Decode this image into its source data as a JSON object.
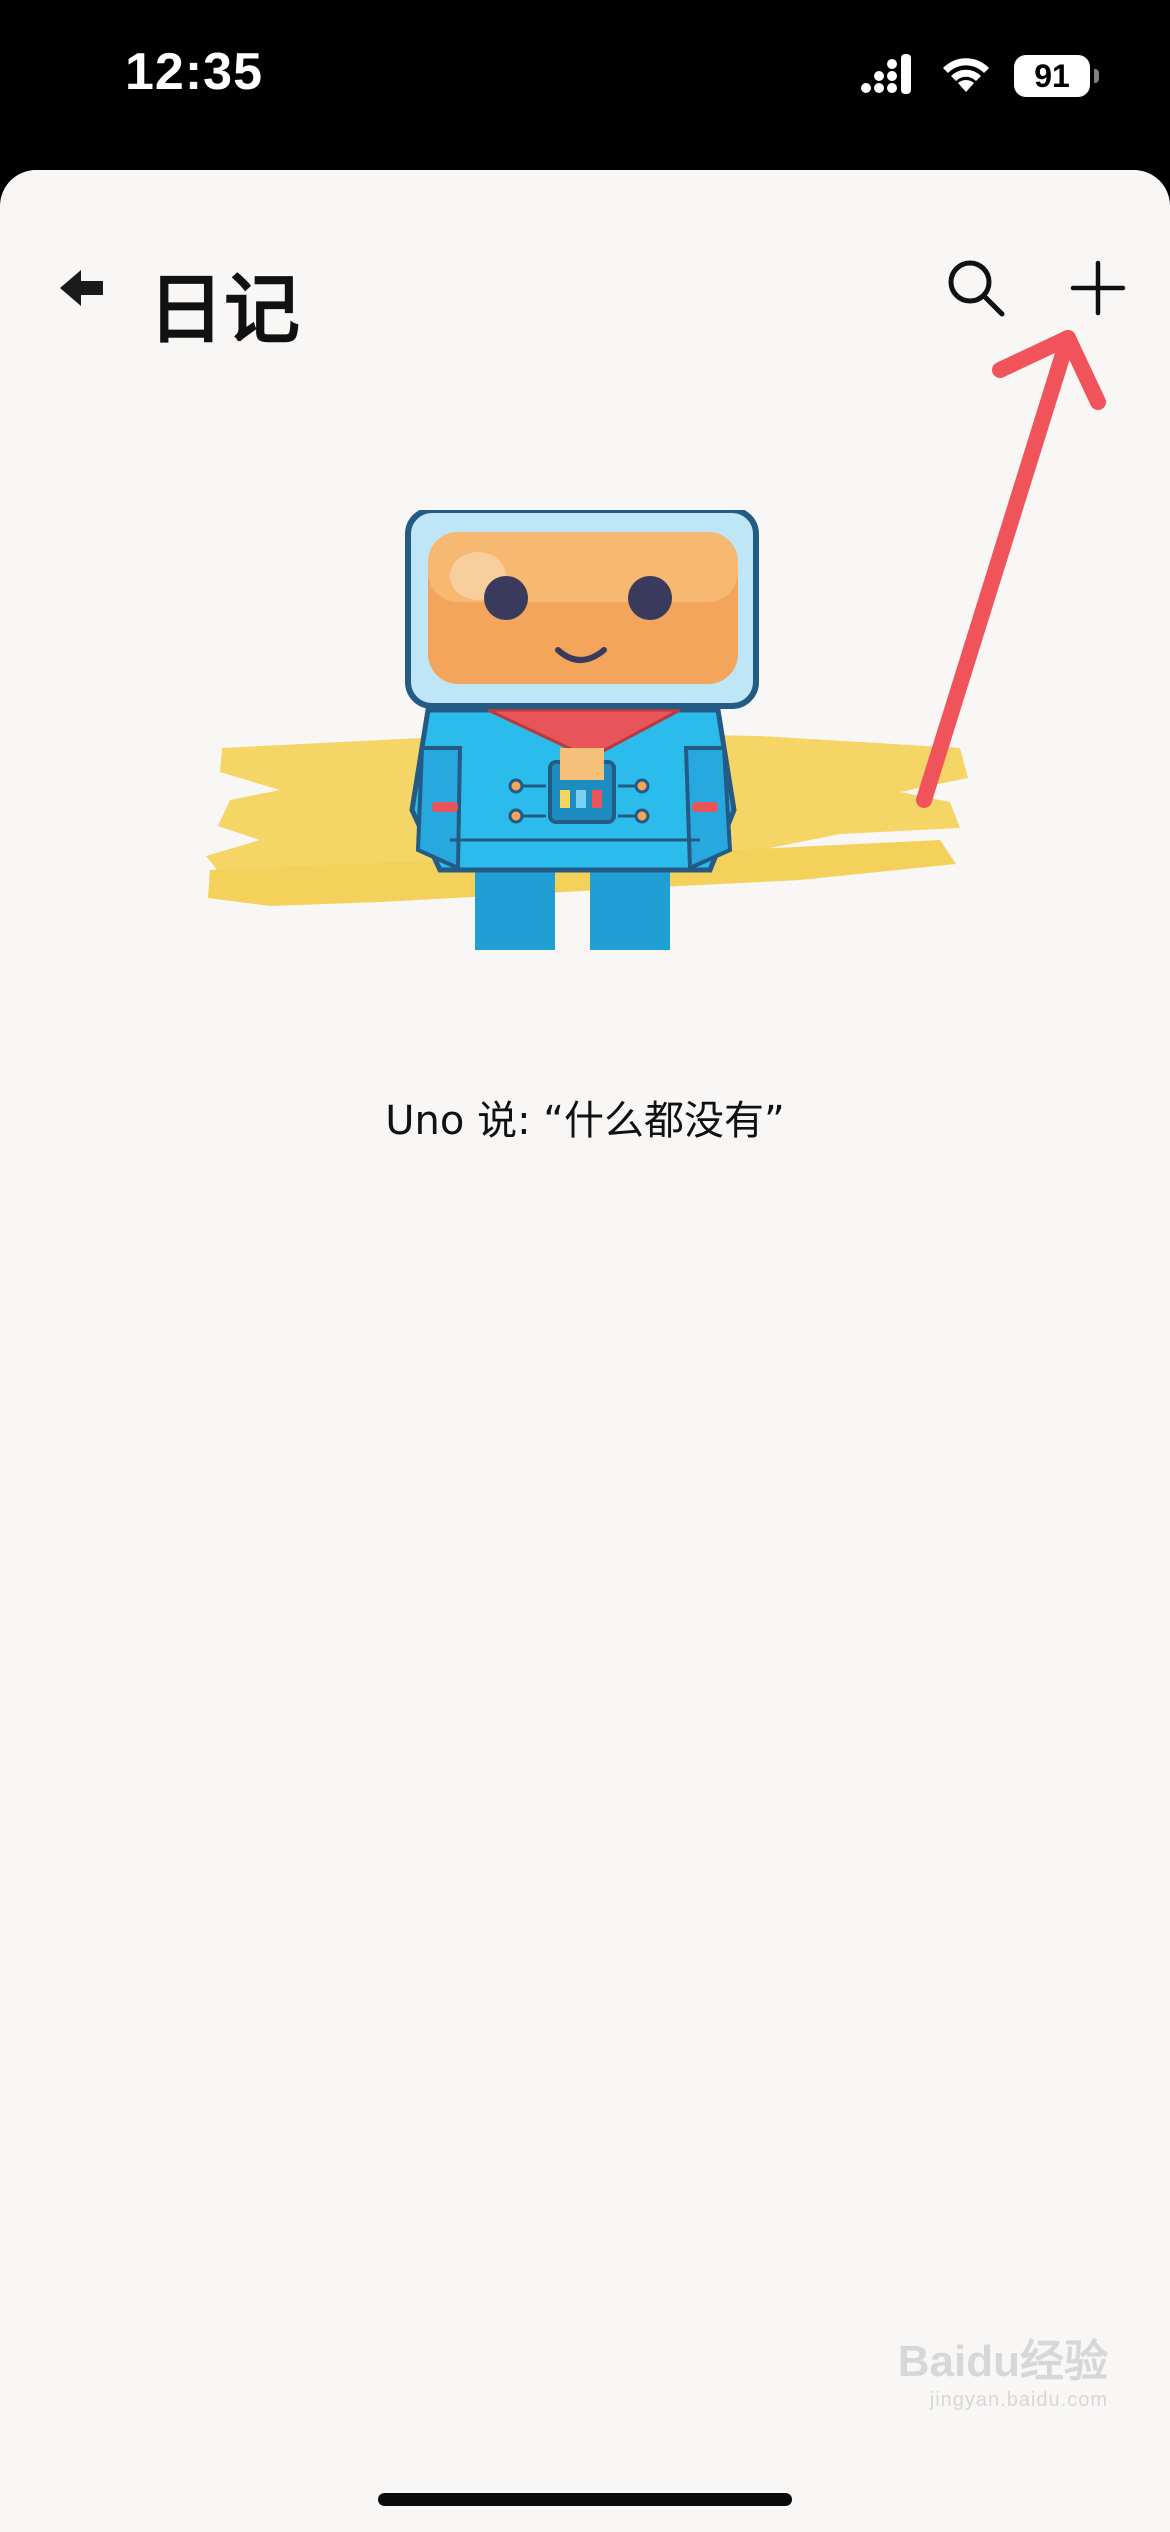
{
  "status_bar": {
    "time": "12:35",
    "battery": "91",
    "icons": [
      "cellular-signal-icon",
      "wifi-icon",
      "battery-icon"
    ]
  },
  "header": {
    "title": "日记",
    "back_icon": "back-arrow-icon",
    "search_icon": "search-icon",
    "add_icon": "plus-icon"
  },
  "empty_state": {
    "illustration": "robot-mascot-illustration",
    "message": "Uno 说: “什么都没有”"
  },
  "watermark": {
    "brand": "Baidu经验",
    "sub": "jingyan.baidu.com"
  },
  "colors": {
    "sheet_background": "#f9f7f5",
    "annotation_arrow": "#f0545a",
    "brush_yellow": "#f5d565",
    "robot_body": "#29b8e8",
    "robot_face": "#f4a55c"
  }
}
